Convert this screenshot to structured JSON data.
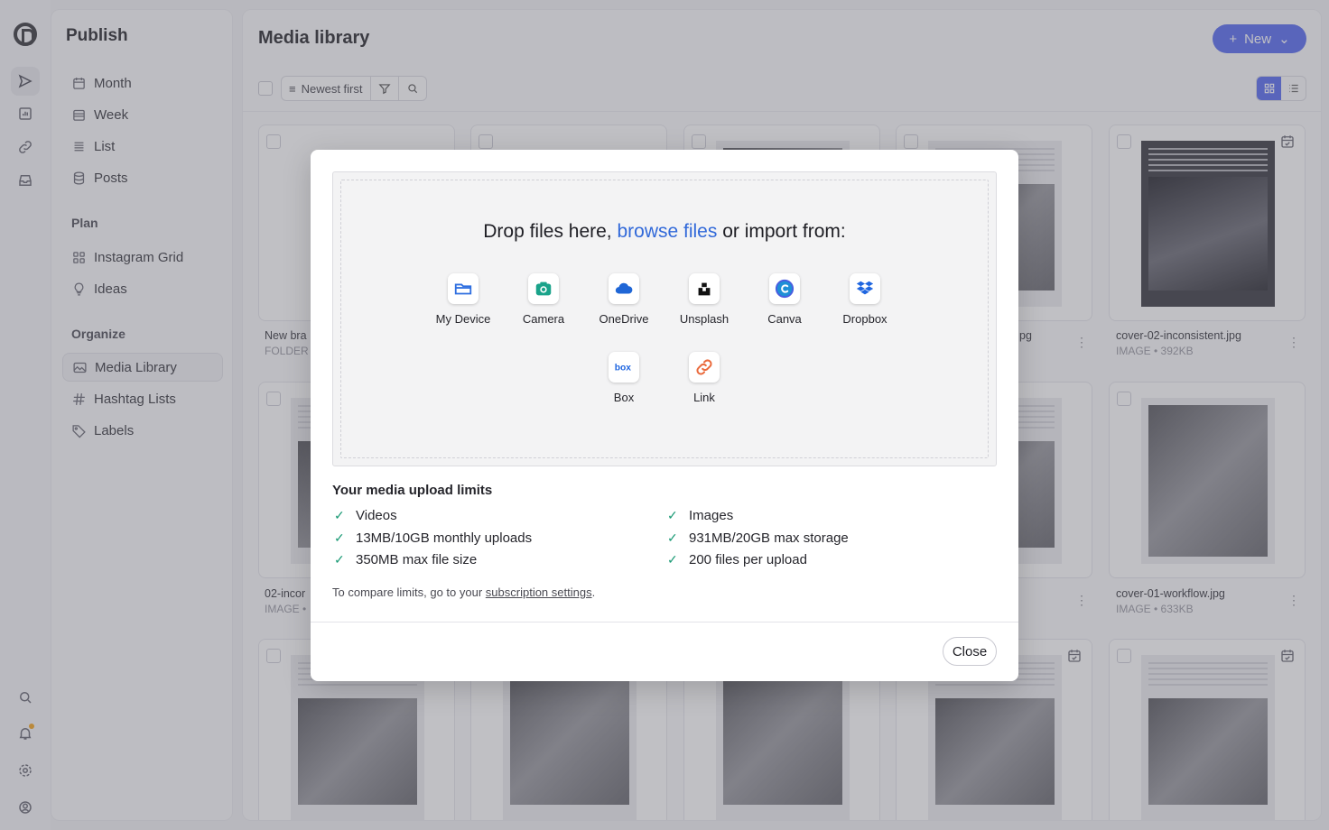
{
  "app": {
    "section": "Publish",
    "page_title": "Media library",
    "new_label": "New"
  },
  "sidebar": {
    "items_top": [
      "Month",
      "Week",
      "List",
      "Posts"
    ],
    "plan_label": "Plan",
    "items_plan": [
      "Instagram Grid",
      "Ideas"
    ],
    "organize_label": "Organize",
    "items_organize": [
      "Media Library",
      "Hashtag Lists",
      "Labels"
    ]
  },
  "toolbar": {
    "sort_label": "Newest first"
  },
  "cards": [
    {
      "name": "New bra",
      "type": "FOLDER"
    },
    {
      "name": "pg",
      "type": ""
    },
    {
      "name": "cover-02-inconsistent.jpg",
      "type": "IMAGE • 392KB"
    },
    {
      "name": "02-incor",
      "type": "IMAGE •"
    },
    {
      "name": "cover-01-workflow.jpg",
      "type": "IMAGE • 633KB"
    }
  ],
  "modal": {
    "drop_prefix": "Drop files here, ",
    "drop_link": "browse files",
    "drop_suffix": " or import from:",
    "sources": [
      "My Device",
      "Camera",
      "OneDrive",
      "Unsplash",
      "Canva",
      "Dropbox",
      "Box",
      "Link"
    ],
    "limits_title": "Your media upload limits",
    "limits_left": [
      "Videos",
      "13MB/10GB monthly uploads",
      "350MB max file size"
    ],
    "limits_right": [
      "Images",
      "931MB/20GB max storage",
      "200 files per upload"
    ],
    "compare_prefix": "To compare limits, go to your ",
    "compare_link": "subscription settings",
    "compare_suffix": ".",
    "close_label": "Close",
    "check_glyph": "✓"
  },
  "colors": {
    "accent": "#5a6df0",
    "link": "#3169d9",
    "check": "#1a9a75",
    "overlay": "rgba(90,90,100,0.38)"
  }
}
